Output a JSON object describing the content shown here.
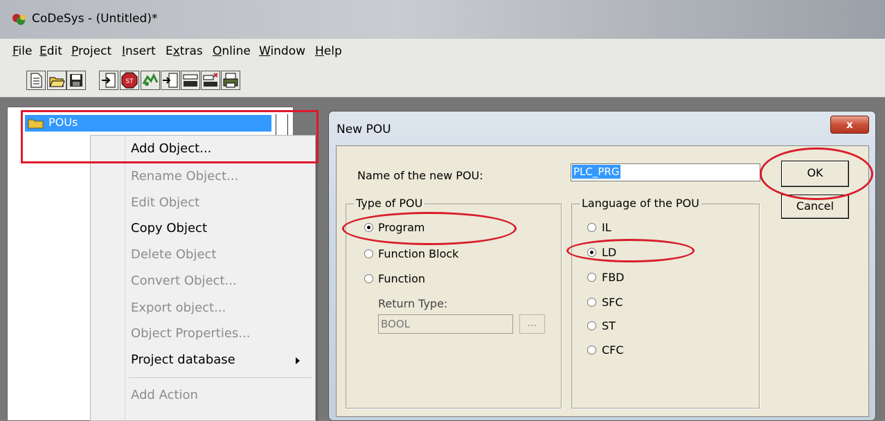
{
  "window": {
    "title": "CoDeSys - (Untitled)*"
  },
  "menubar": [
    {
      "label": "File",
      "u": "F",
      "rest": "ile"
    },
    {
      "label": "Edit",
      "u": "E",
      "rest": "dit"
    },
    {
      "label": "Project",
      "u": "P",
      "rest": "roject"
    },
    {
      "label": "Insert",
      "u": "I",
      "rest": "nsert"
    },
    {
      "label": "Extras",
      "pre": "E",
      "u": "x",
      "rest": "tras"
    },
    {
      "label": "Online",
      "u": "O",
      "rest": "nline"
    },
    {
      "label": "Window",
      "u": "W",
      "rest": "indow"
    },
    {
      "label": "Help",
      "u": "H",
      "rest": "elp"
    }
  ],
  "toolbar": {
    "icons": [
      "new-icon",
      "open-icon",
      "save-icon",
      "login-icon",
      "stop-icon",
      "run-icon",
      "step-icon",
      "monitor-icon",
      "remove-icon",
      "print-icon"
    ]
  },
  "tree": {
    "root": "POUs"
  },
  "context_menu": {
    "items": [
      {
        "label": "Add Object...",
        "enabled": true
      },
      {
        "label": "Rename Object...",
        "enabled": false
      },
      {
        "label": "Edit Object",
        "enabled": false
      },
      {
        "label": "Copy Object",
        "enabled": true
      },
      {
        "label": "Delete Object",
        "enabled": false
      },
      {
        "label": "Convert Object...",
        "enabled": false
      },
      {
        "label": "Export object...",
        "enabled": false
      },
      {
        "label": "Object Properties...",
        "enabled": false
      },
      {
        "label": "Project database",
        "enabled": true,
        "submenu": true
      },
      {
        "label": "Add Action",
        "enabled": false
      }
    ]
  },
  "dialog": {
    "title": "New POU",
    "close": "x",
    "name_label": "Name of the new POU:",
    "name_value": "PLC_PRG",
    "ok": "OK",
    "cancel": "Cancel",
    "type_group": {
      "title": "Type of POU",
      "options": [
        {
          "label": "Program",
          "checked": true
        },
        {
          "label": "Function Block",
          "checked": false
        },
        {
          "label": "Function",
          "checked": false
        }
      ],
      "return_type_label": "Return Type:",
      "return_type_value": "BOOL",
      "browse": "..."
    },
    "lang_group": {
      "title": "Language of the POU",
      "options": [
        {
          "label": "IL",
          "checked": false
        },
        {
          "label": "LD",
          "checked": true
        },
        {
          "label": "FBD",
          "checked": false
        },
        {
          "label": "SFC",
          "checked": false
        },
        {
          "label": "ST",
          "checked": false
        },
        {
          "label": "CFC",
          "checked": false
        }
      ]
    }
  }
}
